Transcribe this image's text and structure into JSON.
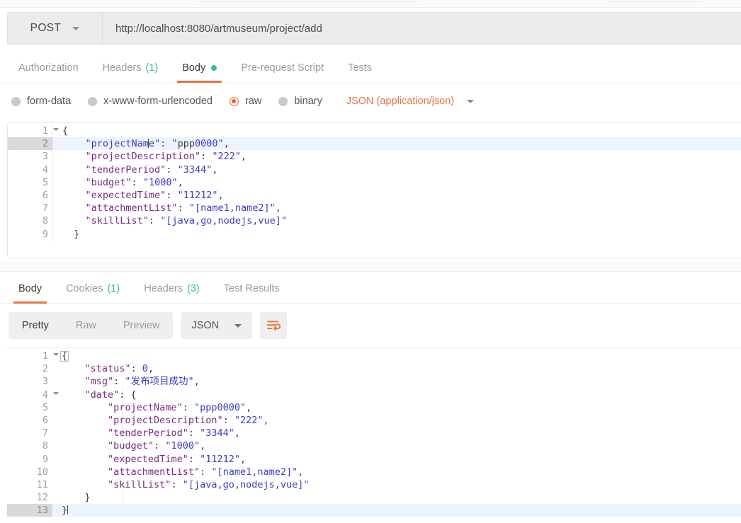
{
  "request_bar": {
    "method": "POST",
    "method_caret_icon": "chevron-down-icon",
    "url": "http://localhost:8080/artmuseum/project/add"
  },
  "request_tabs": [
    {
      "label": "Authorization",
      "count": "",
      "dot": false,
      "active": false
    },
    {
      "label": "Headers",
      "count": "(1)",
      "dot": false,
      "active": false
    },
    {
      "label": "Body",
      "count": "",
      "dot": true,
      "active": true
    },
    {
      "label": "Pre-request Script",
      "count": "",
      "dot": false,
      "active": false
    },
    {
      "label": "Tests",
      "count": "",
      "dot": false,
      "active": false
    }
  ],
  "body_type": {
    "options": [
      {
        "label": "form-data",
        "selected": false
      },
      {
        "label": "x-www-form-urlencoded",
        "selected": false
      },
      {
        "label": "raw",
        "selected": true
      },
      {
        "label": "binary",
        "selected": false
      }
    ],
    "content_type": "JSON (application/json)",
    "content_type_caret_icon": "chevron-down-icon",
    "selected_color": "#ec6123",
    "content_type_color": "#e8734a"
  },
  "request_body": {
    "lines": [
      {
        "n": "1",
        "fold": true,
        "text": "{"
      },
      {
        "n": "2",
        "fold": false,
        "text": "    \"projectName\": \"ppp0000\","
      },
      {
        "n": "3",
        "fold": false,
        "text": "    \"projectDescription\": \"222\","
      },
      {
        "n": "4",
        "fold": false,
        "text": "    \"tenderPeriod\": \"3344\","
      },
      {
        "n": "5",
        "fold": false,
        "text": "    \"budget\": \"1000\","
      },
      {
        "n": "6",
        "fold": false,
        "text": "    \"expectedTime\": \"11212\","
      },
      {
        "n": "7",
        "fold": false,
        "text": "    \"attachmentList\": \"[name1,name2]\","
      },
      {
        "n": "8",
        "fold": false,
        "text": "    \"skillList\": \"[java,go,nodejs,vue]\""
      },
      {
        "n": "9",
        "fold": false,
        "text": "  }"
      }
    ],
    "active_line": "2"
  },
  "response_tabs": [
    {
      "label": "Body",
      "count": "",
      "active": true
    },
    {
      "label": "Cookies",
      "count": "(1)",
      "active": false
    },
    {
      "label": "Headers",
      "count": "(3)",
      "active": false
    },
    {
      "label": "Test Results",
      "count": "",
      "active": false
    }
  ],
  "response_toolbar": {
    "view_modes": [
      {
        "label": "Pretty",
        "active": true
      },
      {
        "label": "Raw",
        "active": false
      },
      {
        "label": "Preview",
        "active": false
      }
    ],
    "format": "JSON",
    "format_caret_icon": "chevron-down-icon",
    "wrap_icon": "word-wrap-icon",
    "wrap_icon_color": "#e8713c"
  },
  "response_body": {
    "lines": [
      {
        "n": "1",
        "fold": true,
        "text": "{"
      },
      {
        "n": "2",
        "fold": false,
        "text": "    \"status\": 0,"
      },
      {
        "n": "3",
        "fold": false,
        "text": "    \"msg\": \"发布项目成功\","
      },
      {
        "n": "4",
        "fold": true,
        "text": "    \"date\": {"
      },
      {
        "n": "5",
        "fold": false,
        "text": "        \"projectName\": \"ppp0000\","
      },
      {
        "n": "6",
        "fold": false,
        "text": "        \"projectDescription\": \"222\","
      },
      {
        "n": "7",
        "fold": false,
        "text": "        \"tenderPeriod\": \"3344\","
      },
      {
        "n": "8",
        "fold": false,
        "text": "        \"budget\": \"1000\","
      },
      {
        "n": "9",
        "fold": false,
        "text": "        \"expectedTime\": \"11212\","
      },
      {
        "n": "10",
        "fold": false,
        "text": "        \"attachmentList\": \"[name1,name2]\","
      },
      {
        "n": "11",
        "fold": false,
        "text": "        \"skillList\": \"[java,go,nodejs,vue]\""
      },
      {
        "n": "12",
        "fold": false,
        "text": "    }"
      },
      {
        "n": "13",
        "fold": false,
        "text": "}"
      }
    ],
    "active_line": "13"
  },
  "theme": {
    "accent": "#e8713c",
    "ok_dot": "#3dbd80",
    "count_green": "#38b88a",
    "json_key": "#7a2a84",
    "json_string": "#3c3cc8",
    "active_line_bg": "#eef4fd"
  }
}
